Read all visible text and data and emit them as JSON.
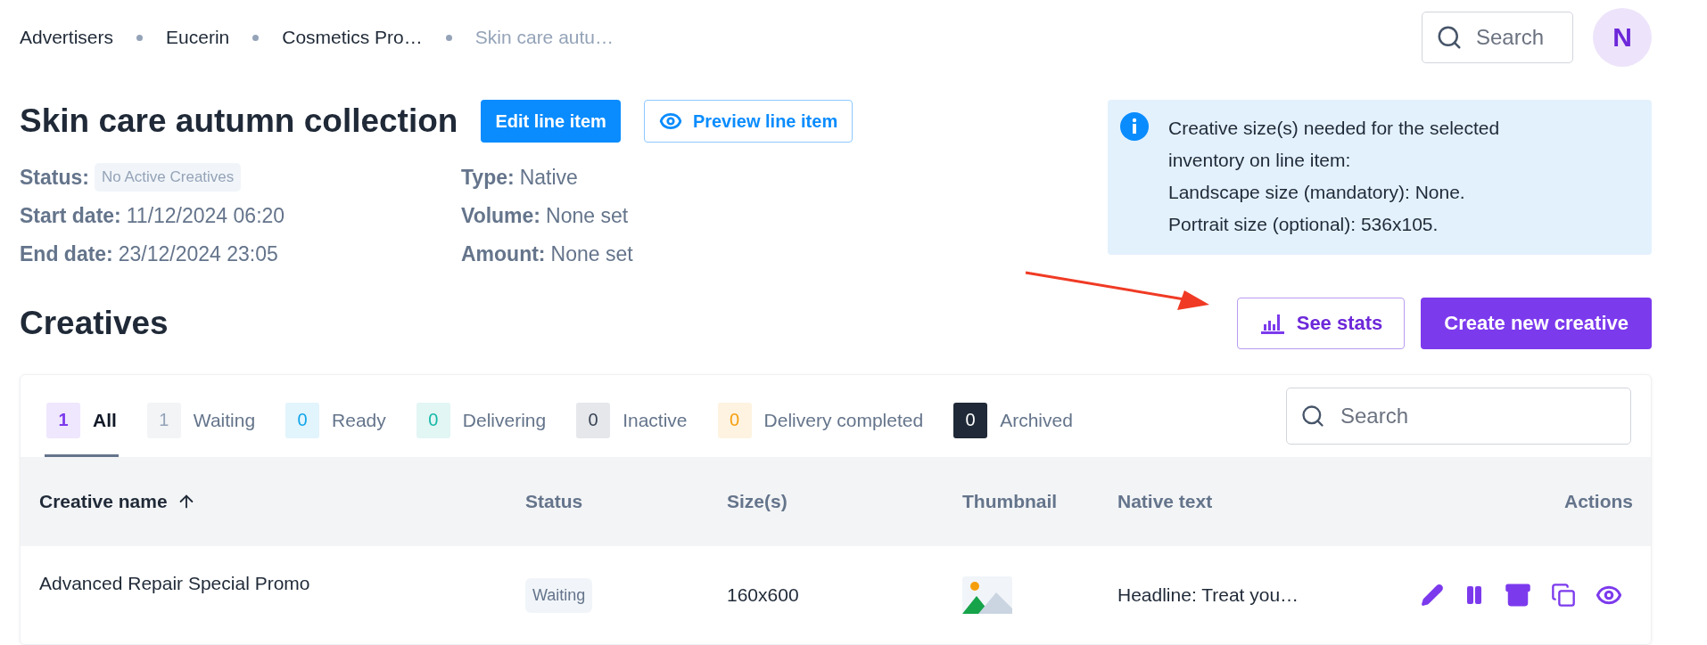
{
  "breadcrumbs": [
    {
      "label": "Advertisers",
      "current": false
    },
    {
      "label": "Eucerin",
      "current": false
    },
    {
      "label": "Cosmetics Pro…",
      "current": false
    },
    {
      "label": "Skin care autu…",
      "current": true
    }
  ],
  "header_search": {
    "placeholder": "Search"
  },
  "avatar": {
    "initial": "N"
  },
  "line_item": {
    "title": "Skin care autumn collection",
    "edit_button": "Edit line item",
    "preview_button": "Preview line item",
    "details_left": [
      {
        "label": "Status:",
        "value": "No Active Creatives",
        "kind": "badge"
      },
      {
        "label": "Start date:",
        "value": "11/12/2024 06:20",
        "kind": "text"
      },
      {
        "label": "End date:",
        "value": "23/12/2024 23:05",
        "kind": "text"
      }
    ],
    "details_right": [
      {
        "label": "Type:",
        "value": "Native",
        "kind": "text"
      },
      {
        "label": "Volume:",
        "value": "None set",
        "kind": "text"
      },
      {
        "label": "Amount:",
        "value": "None set",
        "kind": "text"
      }
    ]
  },
  "info_box": {
    "lines": [
      "Creative size(s) needed for the selected",
      "inventory on line item:",
      "Landscape size (mandatory): None.",
      "Portrait size (optional): 536x105."
    ]
  },
  "creatives": {
    "heading": "Creatives",
    "see_stats_button": "See stats",
    "create_button": "Create new creative",
    "tabs": [
      {
        "count": "1",
        "label": "All",
        "selected": true,
        "color": "#7c3aed"
      },
      {
        "count": "1",
        "label": "Waiting",
        "selected": false,
        "color": "#94a3b8"
      },
      {
        "count": "0",
        "label": "Ready",
        "selected": false,
        "color": "#0ea5e9"
      },
      {
        "count": "0",
        "label": "Delivering",
        "selected": false,
        "color": "#14b8a6"
      },
      {
        "count": "0",
        "label": "Inactive",
        "selected": false,
        "color": "#374151"
      },
      {
        "count": "0",
        "label": "Delivery completed",
        "selected": false,
        "color": "#f59e0b"
      },
      {
        "count": "0",
        "label": "Archived",
        "selected": false,
        "color": "#1f2937"
      }
    ],
    "search": {
      "placeholder": "Search"
    },
    "columns": [
      "Creative name",
      "Status",
      "Size(s)",
      "Thumbnail",
      "Native text",
      "Actions"
    ],
    "rows": [
      {
        "name": "Advanced Repair Special Promo",
        "status": "Waiting",
        "sizes": "160x600",
        "native_text": "Headline: Treat you…"
      }
    ]
  }
}
